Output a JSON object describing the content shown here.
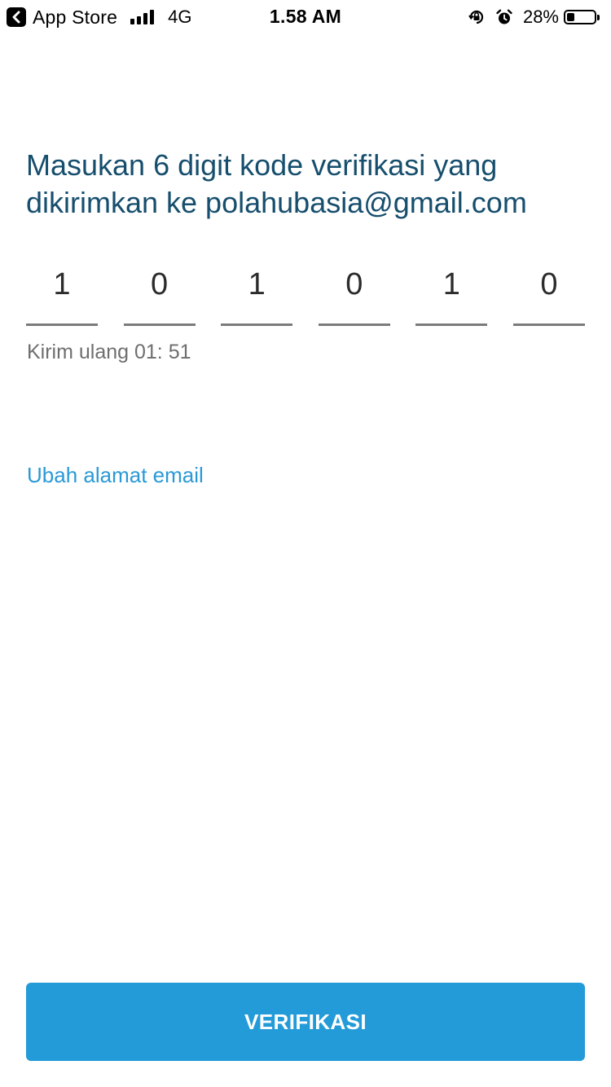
{
  "status_bar": {
    "back_label": "App Store",
    "network": "4G",
    "time": "1.58 AM",
    "battery_percent_label": "28%",
    "battery_level": 0.28,
    "icons": [
      "back-arrow-icon",
      "signal-bars-icon",
      "orientation-lock-icon",
      "alarm-clock-icon",
      "battery-icon"
    ]
  },
  "verification": {
    "title_line1": "Masukan 6 digit kode verifikasi yang",
    "title_line2": "dikirimkan ke polahubasia@gmail.com",
    "code_digits": [
      "1",
      "0",
      "1",
      "0",
      "1",
      "0"
    ],
    "resend_text": "Kirim ulang 01: 51",
    "change_email_link": "Ubah alamat email",
    "submit_button": "VERIFIKASI"
  },
  "colors": {
    "title": "#164e6d",
    "link": "#2a99d6",
    "button_background": "#239bd8",
    "button_text": "#ffffff",
    "underline": "#7b7b7b",
    "muted_text": "#6e6e6e"
  }
}
